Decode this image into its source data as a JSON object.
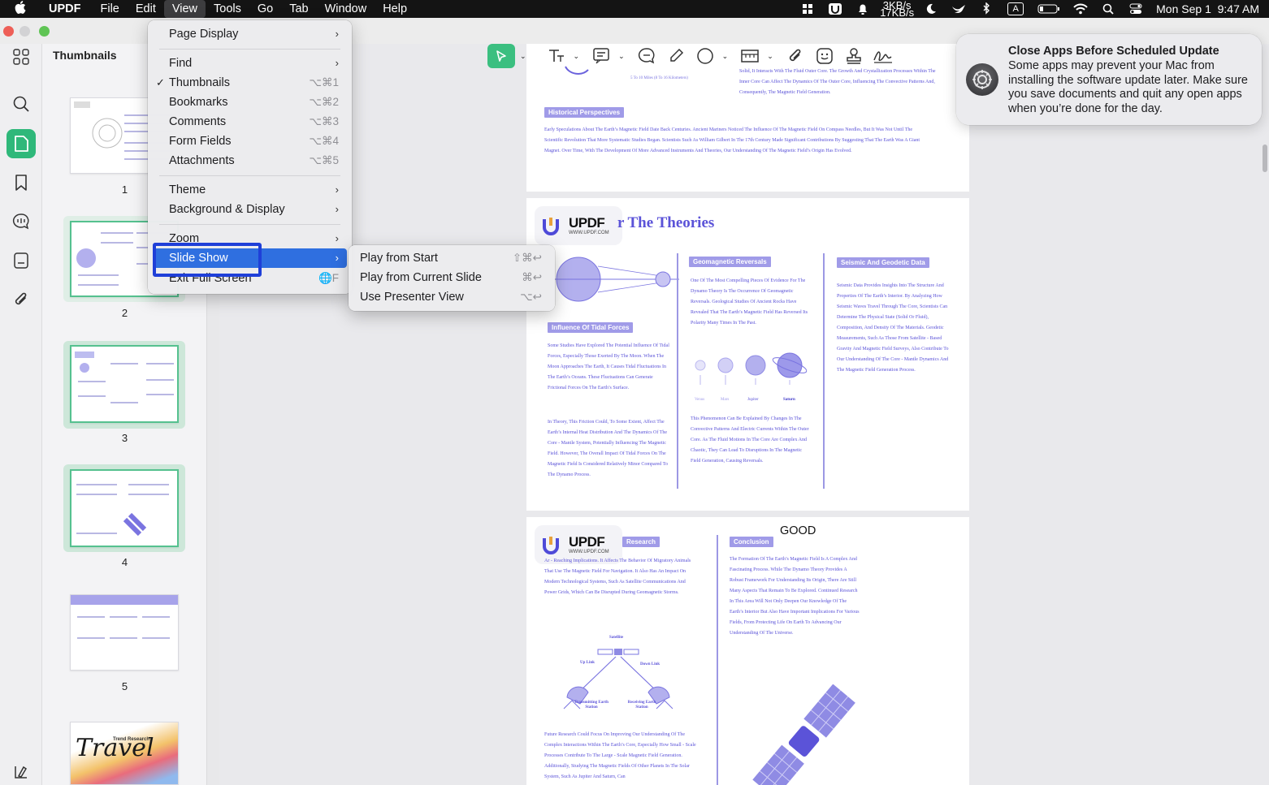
{
  "menubar": {
    "app": "UPDF",
    "items": [
      "File",
      "Edit",
      "View",
      "Tools",
      "Go",
      "Tab",
      "Window",
      "Help"
    ],
    "active": "View",
    "network": {
      "up": "3KB/s",
      "down": "17KB/s"
    },
    "datetime": "Mon Sep 1  9:47 AM",
    "input_source": "A"
  },
  "sidebar": {
    "panel_title": "Thumbnails",
    "pages": [
      "1",
      "2",
      "3",
      "4",
      "5"
    ],
    "selected_page": "3",
    "page6_text": {
      "script": "Travel",
      "caption": "Trend Research"
    }
  },
  "view_menu": {
    "items": [
      {
        "label": "Page Display",
        "submenu": true
      },
      {
        "label": "Find",
        "submenu": true
      },
      {
        "label": "Thumbnails",
        "checked": true,
        "shortcut": "⌥⌘1"
      },
      {
        "label": "Bookmarks",
        "shortcut": "⌥⌘2"
      },
      {
        "label": "Comments",
        "shortcut": "⌥⌘3"
      },
      {
        "label": "Form Fields",
        "shortcut": "⌥⌘4"
      },
      {
        "label": "Attachments",
        "shortcut": "⌥⌘5"
      },
      {
        "label": "Theme",
        "submenu": true
      },
      {
        "label": "Background & Display",
        "submenu": true
      },
      {
        "label": "Zoom",
        "submenu": true
      },
      {
        "label": "Slide Show",
        "submenu": true,
        "highlighted": true
      },
      {
        "label": "Exit Full Screen",
        "shortcut": "🌐F"
      }
    ],
    "check_glyph": "✓",
    "chevron": "›"
  },
  "slideshow_menu": {
    "items": [
      {
        "label": "Play from Start",
        "shortcut": "⇧⌘↩"
      },
      {
        "label": "Play from Current Slide",
        "shortcut": "⌘↩"
      },
      {
        "label": "Use Presenter View",
        "shortcut": "⌥↩"
      }
    ]
  },
  "notification": {
    "title": "Close Apps Before Scheduled Update",
    "body": "Some apps may prevent your Mac from installing the software update later. Make sure you save documents and quit any open apps when you’re done for the day."
  },
  "document": {
    "page1": {
      "badge": "Historical Perspectives",
      "top_right_text": "Solid, It Interacts With The Fluid Outer Core. The Growth And Crystallization Processes Within The Inner Core Can Affect The Dynamics Of The Outer Core, Influencing The Convective Patterns And, Consequently, The Magnetic Field Generation.",
      "small_caption": "5 To 10 Miles (8 To 16 Kilometers)",
      "body": "Early Speculations About The Earth’s Magnetic Field Date Back Centuries. Ancient Mariners Noticed The Influence Of The Magnetic Field On Compass Needles, But It Was Not Until The Scientific Revolution That More Systematic Studies Began. Scientists Such As William Gilbert In The 17th Century Made Significant Contributions By Suggesting That The Earth Was A Giant Magnet. Over Time, With The Development Of More Advanced Instruments And Theories, Our Understanding Of The Magnetic Field’s Origin Has Evolved."
    },
    "page2": {
      "heading": "r The Theories",
      "logo": {
        "name": "UPDF",
        "url": "WWW.UPDF.COM"
      },
      "badges": {
        "geo": "Geomagnetic Reversals",
        "seismic": "Seismic And Geodetic Data",
        "tidal": "Influence Of Tidal Forces"
      },
      "geo_text": "One Of The Most Compelling Pieces Of Evidence For The Dynamo Theory Is The Occurrence Of Geomagnetic Reversals. Geological Studies Of Ancient Rocks Have Revealed That The Earth’s Magnetic Field Has Reversed Its Polarity Many Times In The Past.",
      "seismic_text": "Seismic Data Provides Insights Into The Structure And Properties Of The Earth’s Interior. By Analyzing How Seismic Waves Travel Through The Core, Scientists Can Determine The Physical State (Solid Or Fluid), Composition, And Density Of The Materials. Geodetic Measurements, Such As Those From Satellite - Based Gravity And Magnetic Field Surveys, Also Contribute To Our Understanding Of The Core - Mantle Dynamics And The Magnetic Field Generation Process.",
      "tidal_text1": "Some Studies Have Explored The Potential Influence Of Tidal Forces, Especially Those Exerted By The Moon. When The Moon Approaches The Earth, It Causes Tidal Fluctuations In The Earth’s Oceans. These Fluctuations Can Generate Frictional Forces On The Earth’s Surface.",
      "tidal_text2": "In Theory, This Friction Could, To Some Extent, Affect The Earth’s Internal Heat Distribution And The Dynamics Of The Core - Mantle System, Potentially Influencing The Magnetic Field. However, The Overall Impact Of Tidal Forces On The Magnetic Field Is Considered Relatively Minor Compared To The Dynamo Process.",
      "phenom_text": "This Phenomenon Can Be Explained By Changes In The Convective Patterns And Electric Currents Within The Outer Core. As The Fluid Motions In The Core Are Complex And Chaotic, They Can Lead To Disruptions In The Magnetic Field Generation, Causing Reversals.",
      "planets": [
        "Venus",
        "Mars",
        "Jupiter",
        "Saturn"
      ]
    },
    "page3": {
      "annotation": "GOOD",
      "logo": {
        "name": "UPDF",
        "url": "WWW.UPDF.COM"
      },
      "badges": {
        "research": "Research",
        "conclusion": "Conclusion"
      },
      "left_text": "Ar - Reaching Implications. It Affects The Behavior Of Migratory Animals That Use The Magnetic Field For Navigation. It Also Has An Impact On Modern Technological Systems, Such As Satellite Communications And Power Grids, Which Can Be Disrupted During Geomagnetic Storms.",
      "conclusion_text": "The Formation Of The Earth’s Magnetic Field Is A Complex And Fascinating Process. While The Dynamo Theory Provides A Robust Framework For Understanding Its Origin, There Are Still Many Aspects That Remain To Be Explored. Continued Research In This Area Will Not Only Deepen Our Knowledge Of The Earth’s Interior But Also Have Important Implications For Various Fields, From Protecting Life On Earth To Advancing Our Understanding Of The Universe.",
      "diagram": {
        "satellite": "Satellite",
        "uplink": "Up Link",
        "downlink": "Down Link",
        "tx": "Transmitting Earth Station",
        "rx": "Receiving Earth Station"
      },
      "future_text": "Future Research Could Focus On Improving Our Understanding Of The Complex Interactions Within The Earth’s Core, Especially How Small - Scale Processes Contribute To The Large - Scale Magnetic Field Generation. Additionally, Studying The Magnetic Fields Of Other Planets In The Solar System, Such As Jupiter And Saturn, Can"
    }
  },
  "colors": {
    "accent_green": "#2fb87a",
    "menu_highlight": "#2f6fe0",
    "doc_purple": "#5b53d8"
  }
}
